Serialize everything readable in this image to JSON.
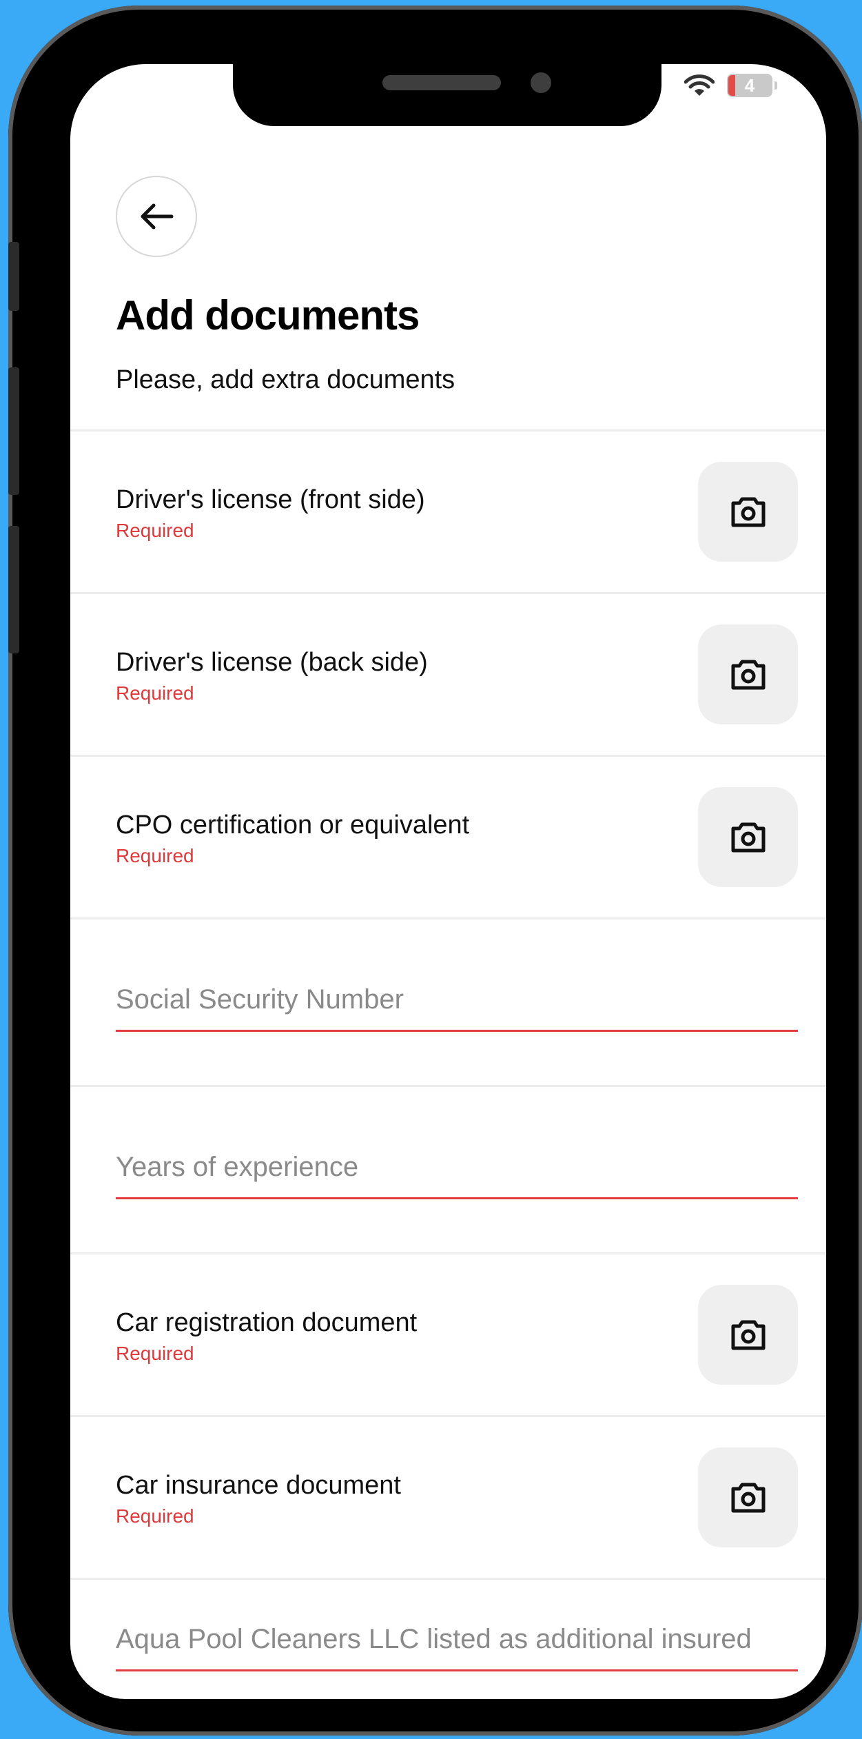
{
  "status": {
    "battery": "4"
  },
  "header": {
    "title": "Add documents",
    "subtitle": "Please, add extra documents"
  },
  "documents": [
    {
      "label": "Driver's license (front side)",
      "status": "Required"
    },
    {
      "label": "Driver's license (back side)",
      "status": "Required"
    },
    {
      "label": "CPO certification or equivalent",
      "status": "Required"
    },
    {
      "label": "Car registration document",
      "status": "Required"
    },
    {
      "label": "Car insurance document",
      "status": "Required"
    }
  ],
  "fields": {
    "ssn": {
      "placeholder": "Social Security Number"
    },
    "experience": {
      "placeholder": "Years of experience"
    },
    "additional_insured": {
      "placeholder": "Aqua Pool Cleaners LLC listed as additional insured"
    }
  },
  "colors": {
    "background": "#3aaaf7",
    "required": "#e0393b",
    "field_underline": "#e43c3c",
    "camera_button": "#efefef"
  }
}
